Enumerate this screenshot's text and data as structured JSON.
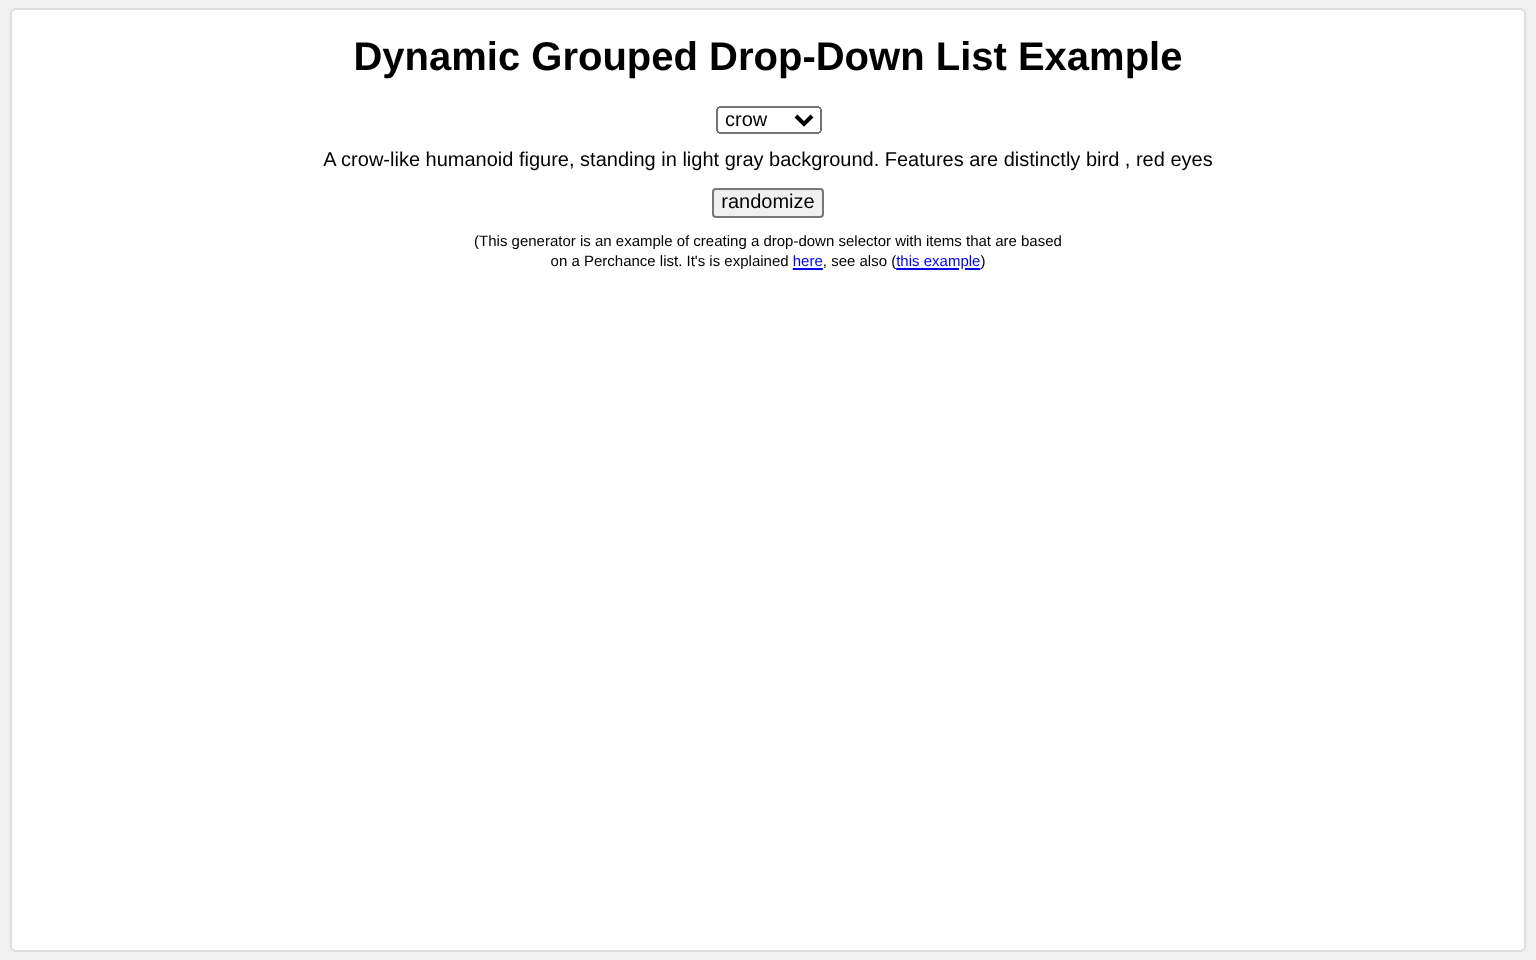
{
  "title": "Dynamic Grouped Drop-Down List Example",
  "dropdown": {
    "value": "crow"
  },
  "description": "A crow-like humanoid figure, standing in light gray background. Features are distinctly bird , red eyes",
  "button": "randomize",
  "note": {
    "before": "(This generator is an example of creating a drop-down selector with items that are based on a Perchance list. It's is explained ",
    "link_1": "here",
    "middle": ", see also (",
    "link_2": "this example",
    "after": ")"
  }
}
